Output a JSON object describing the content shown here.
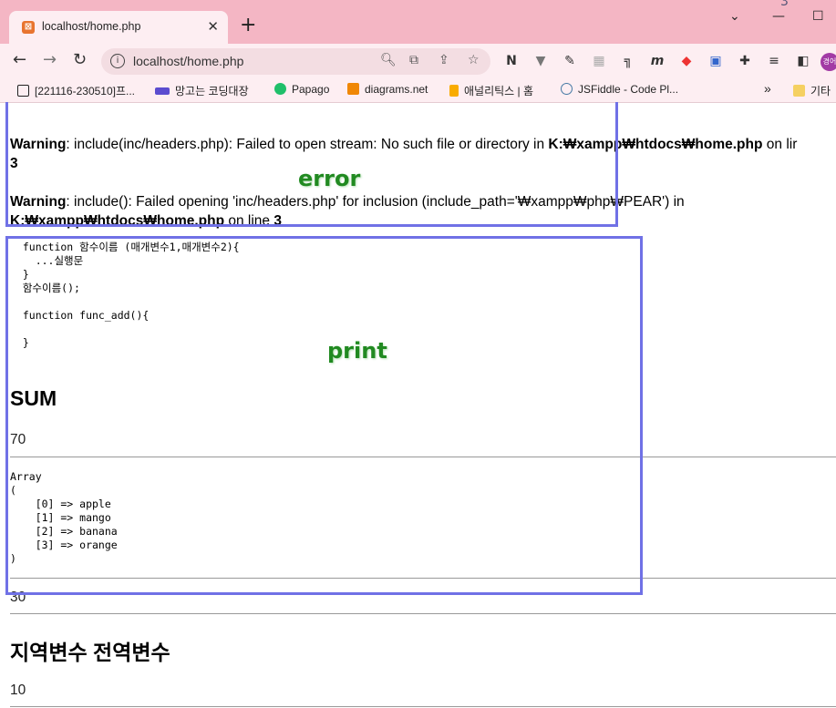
{
  "browser": {
    "tab": {
      "title": "localhost/home.php"
    },
    "url": "localhost/home.php",
    "bookmarks": [
      {
        "label": "[221116-230510]프...",
        "color": "#222222"
      },
      {
        "label": "망고는 코딩대장",
        "color": "#5b4ccf"
      },
      {
        "label": "Papago",
        "color": "#1fbf6a"
      },
      {
        "label": "diagrams.net",
        "color": "#f08705"
      },
      {
        "label": "애널리틱스 | 홈",
        "color": "#f9ab00"
      },
      {
        "label": "JSFiddle - Code Pl...",
        "color": "#4679a4"
      },
      {
        "label": "기타",
        "color": "#f5d061"
      }
    ],
    "overflow_label": "»",
    "profile_label": "경어",
    "corner_digit": "3"
  },
  "page": {
    "warnings": [
      {
        "label": "Warning",
        "text": ": include(inc/headers.php): Failed to open stream: No such file or directory in ",
        "path": "K:₩xampp₩htdocs₩home.php",
        "tail": " on lir",
        "line": "3"
      },
      {
        "label": "Warning",
        "text": ": include(): Failed opening 'inc/headers.php' for inclusion (include_path='₩xampp₩php₩PEAR') in",
        "path": "K:₩xampp₩htdocs₩home.php",
        "tail": " on line ",
        "line": "3"
      }
    ],
    "code_block": "  function 함수이름 (매개변수1,매개변수2){\n    ...실행문\n  }\n  함수이름();\n\n  function func_add(){\n\n  }",
    "sum_heading": "SUM",
    "sum_value": "70",
    "array_dump": "Array\n(\n    [0] => apple\n    [1] => mango\n    [2] => banana\n    [3] => orange\n)",
    "value_30": "30",
    "var_heading": "지역변수 전역변수",
    "value_10": "10"
  },
  "annotations": {
    "error_label": "error",
    "print_label": "print",
    "box_color": "#7071e6",
    "label_color": "#218a21"
  }
}
